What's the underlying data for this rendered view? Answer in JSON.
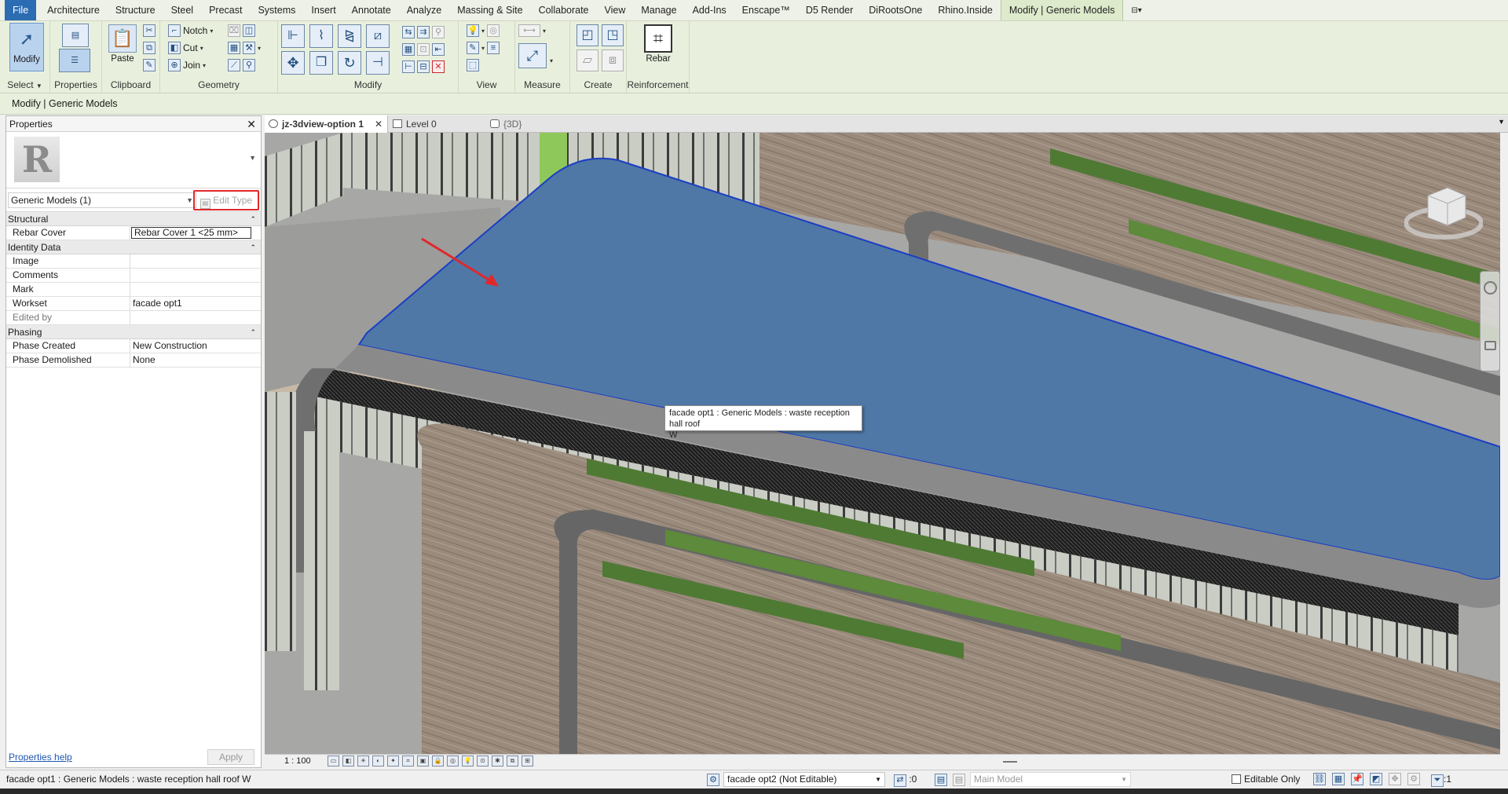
{
  "ribbon": {
    "tabs": [
      "File",
      "Architecture",
      "Structure",
      "Steel",
      "Precast",
      "Systems",
      "Insert",
      "Annotate",
      "Analyze",
      "Massing & Site",
      "Collaborate",
      "View",
      "Manage",
      "Add-Ins",
      "Enscape™",
      "D5 Render",
      "DiRootsOne",
      "Rhino.Inside",
      "Modify | Generic Models"
    ],
    "panels": {
      "select": {
        "modify_label": "Modify",
        "label": "Select"
      },
      "properties": {
        "label": "Properties"
      },
      "clipboard": {
        "paste_label": "Paste",
        "label": "Clipboard"
      },
      "geometry": {
        "notch_label": "Notch",
        "cut_label": "Cut",
        "join_label": "Join",
        "label": "Geometry"
      },
      "modify": {
        "label": "Modify"
      },
      "view": {
        "label": "View"
      },
      "measure": {
        "label": "Measure"
      },
      "create": {
        "label": "Create"
      },
      "reinforcement": {
        "rebar_label": "Rebar",
        "label": "Reinforcement"
      }
    }
  },
  "context_bar": {
    "text": "Modify | Generic Models"
  },
  "properties": {
    "title": "Properties",
    "type_selector": "Generic Models (1)",
    "edit_type_label": "Edit Type",
    "groups": {
      "structural": {
        "title": "Structural",
        "rows": [
          {
            "key": "Rebar Cover",
            "value": "Rebar Cover 1 <25 mm>"
          }
        ]
      },
      "identity": {
        "title": "Identity Data",
        "rows": [
          {
            "key": "Image",
            "value": ""
          },
          {
            "key": "Comments",
            "value": ""
          },
          {
            "key": "Mark",
            "value": ""
          },
          {
            "key": "Workset",
            "value": "facade opt1"
          },
          {
            "key": "Edited by",
            "value": ""
          }
        ]
      },
      "phasing": {
        "title": "Phasing",
        "rows": [
          {
            "key": "Phase Created",
            "value": "New Construction"
          },
          {
            "key": "Phase Demolished",
            "value": "None"
          }
        ]
      }
    },
    "help_link": "Properties help",
    "apply_label": "Apply"
  },
  "view_tabs": [
    {
      "label": "jz-3dview-option 1"
    },
    {
      "label": "Level 0"
    },
    {
      "label": "{3D}"
    }
  ],
  "viewport": {
    "tooltip_line1": "facade opt1 : Generic Models : waste reception hall roof",
    "tooltip_line2": "W",
    "selection_color": "#4f78a6"
  },
  "view_control_bar": {
    "scale": "1 : 100"
  },
  "status_bar": {
    "message": "facade opt1 : Generic Models : waste reception hall roof  W",
    "workset": "facade opt2 (Not Editable)",
    "count": ":0",
    "design_option": "Main Model",
    "editable_only_label": "Editable Only",
    "filter_count": ":1"
  }
}
